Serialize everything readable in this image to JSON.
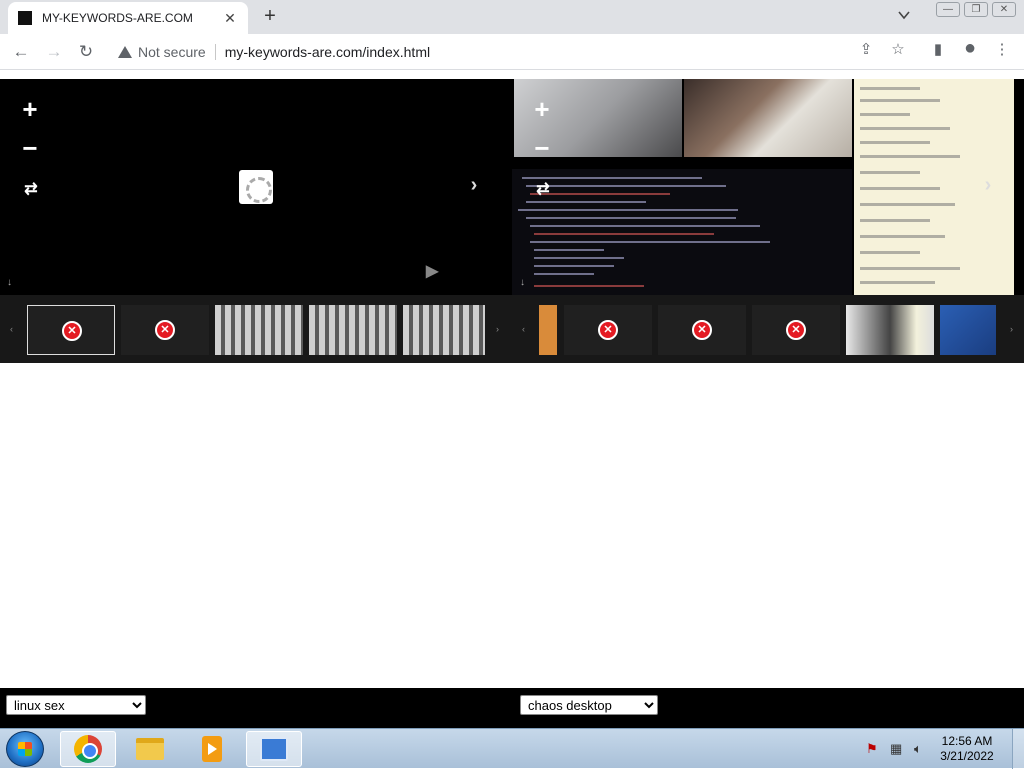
{
  "browser": {
    "tab_title": "MY-KEYWORDS-ARE.COM",
    "tab_close": "✕",
    "new_tab": "+",
    "security_label": "Not secure",
    "url": "my-keywords-are.com/index.html",
    "window_buttons": [
      "—",
      "❐",
      "✕"
    ]
  },
  "nav": {
    "back": "←",
    "forward": "→",
    "reload": "↻"
  },
  "toolbar_icons": {
    "share": "⇪",
    "bookmark": "☆",
    "sidepanel": "▮",
    "profile": "●",
    "menu": "⋮"
  },
  "left_viewer": {
    "zoom_in": "+",
    "zoom_out": "−",
    "cycle": "⇄",
    "next": "›",
    "download": "↓",
    "play": "▶",
    "fullscreen": "⤢",
    "loading": true
  },
  "right_viewer": {
    "zoom_in": "+",
    "zoom_out": "−",
    "cycle": "⇄",
    "next": "›",
    "download": "↓"
  },
  "left_strip": {
    "prev": "‹",
    "next": "›",
    "thumbnails": [
      {
        "kind": "error",
        "selected": true,
        "glyph": "✕"
      },
      {
        "kind": "error",
        "selected": false,
        "glyph": "✕"
      },
      {
        "kind": "photo"
      },
      {
        "kind": "photo"
      },
      {
        "kind": "photo"
      }
    ]
  },
  "right_strip": {
    "prev": "‹",
    "next": "›",
    "thumbnails": [
      {
        "kind": "partial-orange"
      },
      {
        "kind": "error",
        "glyph": "✕"
      },
      {
        "kind": "error",
        "glyph": "✕"
      },
      {
        "kind": "error",
        "glyph": "✕"
      },
      {
        "kind": "desktop"
      },
      {
        "kind": "blue"
      }
    ]
  },
  "selectors": {
    "left_value": "linux sex",
    "right_value": "chaos desktop"
  },
  "taskbar": {
    "time": "12:56 AM",
    "date": "3/21/2022",
    "tray_icons": [
      "network-warning-icon",
      "network-icon",
      "volume-icon"
    ]
  }
}
